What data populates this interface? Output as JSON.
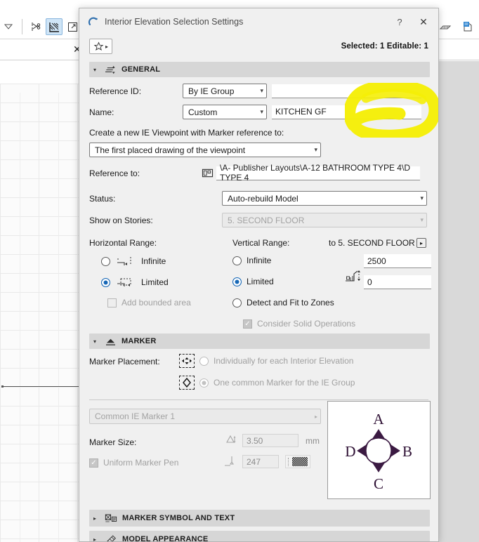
{
  "app": {
    "toolbar_icons": [
      "dropdown-triangle-icon",
      "scissors-trim-icon",
      "fill-hatch-icon",
      "expand-arrow-icon"
    ],
    "toolbar_right_icons": [
      "brick-wall-icon",
      "building-info-icon",
      "roof-icon"
    ],
    "close_label": "✕"
  },
  "dialog": {
    "title": "Interior Elevation Selection Settings",
    "title_icon": "interior-elevation-icon",
    "help_label": "?",
    "close_label": "✕",
    "favorites_icon": "star-icon",
    "favorites_arrow": "▸",
    "selection_status": "Selected: 1 Editable: 1"
  },
  "general": {
    "section_label": "GENERAL",
    "section_icon": "interior-elevation-section-icon",
    "collapse_arrow": "▾",
    "reference_id_label": "Reference ID:",
    "reference_id_value": "By IE Group",
    "reference_id_text": "",
    "name_label": "Name:",
    "name_mode": "Custom",
    "name_value": "KITCHEN GF",
    "viewpoint_label": "Create a new IE Viewpoint with Marker reference to:",
    "viewpoint_value": "The first placed drawing of the viewpoint",
    "reference_to_label": "Reference to:",
    "reference_to_icon": "layout-book-icon",
    "reference_to_value": "\\A- Publisher Layouts\\A-12 BATHROOM TYPE 4\\D TYPE 4",
    "status_label": "Status:",
    "status_value": "Auto-rebuild Model",
    "stories_label": "Show on Stories:",
    "stories_value": "5. SECOND FLOOR"
  },
  "ranges": {
    "horizontal_label": "Horizontal Range:",
    "vertical_label": "Vertical Range:",
    "to_story_label": "to 5. SECOND FLOOR",
    "to_story_arrow": "▸",
    "horizontal_options": [
      {
        "label": "Infinite",
        "selected": false,
        "icon": "range-infinite-icon"
      },
      {
        "label": "Limited",
        "selected": true,
        "icon": "range-limited-icon"
      }
    ],
    "add_bounded_label": "Add bounded area",
    "add_bounded_checked": false,
    "vertical_options": [
      {
        "label": "Infinite",
        "selected": false
      },
      {
        "label": "Limited",
        "selected": true
      },
      {
        "label": "Detect and Fit to Zones",
        "selected": false
      }
    ],
    "consider_solid_label": "Consider Solid Operations",
    "consider_solid_checked": true,
    "height_icon": "elevation-height-icon",
    "top_value": "2500",
    "bottom_value": "0"
  },
  "marker": {
    "section_label": "MARKER",
    "section_icon": "marker-section-icon",
    "collapse_arrow": "▾",
    "placement_label": "Marker Placement:",
    "placement_options": [
      {
        "label": "Individually for each Interior Elevation",
        "selected": false,
        "icon": "individual-markers-icon"
      },
      {
        "label": "One common Marker for the IE Group",
        "selected": true,
        "icon": "common-marker-icon"
      }
    ],
    "common_marker_name": "Common IE Marker 1",
    "common_marker_arrow": "▸",
    "size_label": "Marker Size:",
    "size_icon": "marker-size-icon",
    "size_value": "3.50",
    "size_unit": "mm",
    "uniform_pen_label": "Uniform Marker Pen",
    "uniform_pen_checked": true,
    "pen_icon": "pen-icon",
    "pen_value": "247",
    "pen_swatch": "pen-color-swatch",
    "preview_labels": {
      "top": "A",
      "right": "B",
      "bottom": "C",
      "left": "D"
    },
    "preview_color": "#3b1a42"
  },
  "sections": [
    {
      "label": "MARKER SYMBOL AND TEXT",
      "icon": "marker-symbol-text-icon",
      "arrow": "▸"
    },
    {
      "label": "MODEL APPEARANCE",
      "icon": "model-appearance-icon",
      "arrow": "▸"
    }
  ],
  "annotation": {
    "type": "highlighter-scribble",
    "color": "#f5ee07"
  }
}
